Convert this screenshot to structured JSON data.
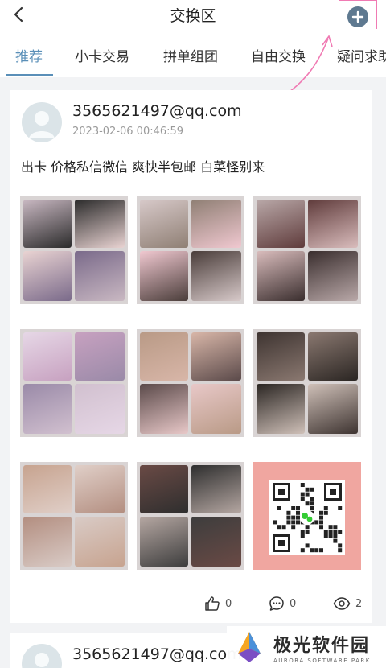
{
  "header": {
    "title": "交换区"
  },
  "tabs": [
    {
      "label": "推荐",
      "active": true
    },
    {
      "label": "小卡交易",
      "active": false
    },
    {
      "label": "拼单组团",
      "active": false
    },
    {
      "label": "自由交换",
      "active": false
    },
    {
      "label": "疑问求助",
      "active": false
    }
  ],
  "posts": [
    {
      "username": "3565621497@qq.com",
      "timestamp": "2023-02-06 00:46:59",
      "text": "出卡 价格私信微信 爽快半包邮 白菜怪别来",
      "photos": [
        {
          "kind": "photocard-binder-page",
          "colors": [
            "#c9b8c2",
            "#2b2b2b",
            "#e9d3d2",
            "#7a6a8a"
          ]
        },
        {
          "kind": "photocard-binder-page",
          "colors": [
            "#d7c9c9",
            "#8f7f74",
            "#f0c8d0",
            "#4a3d3a"
          ]
        },
        {
          "kind": "photocard-binder-page",
          "colors": [
            "#b9a8a8",
            "#5f3b3b",
            "#d9bcbc",
            "#3a2e2e"
          ]
        },
        {
          "kind": "photocard-binder-page",
          "colors": [
            "#e6d7e6",
            "#c7a1c0",
            "#9a8aa8",
            "#d1c0cf"
          ]
        },
        {
          "kind": "photocard-binder-page",
          "colors": [
            "#b99a86",
            "#d8b6a8",
            "#5b4a4a",
            "#e8c8c8"
          ]
        },
        {
          "kind": "photocard-binder-page",
          "colors": [
            "#3e3431",
            "#8a7870",
            "#2b2623",
            "#cfc0b8"
          ]
        },
        {
          "kind": "photocard-binder-page",
          "colors": [
            "#c7a38f",
            "#e0cfc8",
            "#b38e80",
            "#d9cbc6"
          ]
        },
        {
          "kind": "photocard-binder-page",
          "colors": [
            "#6a4a45",
            "#2e2e2e",
            "#b5a7a2",
            "#3d3d3d"
          ]
        },
        {
          "kind": "wechat-qr-code",
          "colors": [
            "#f0a6a0",
            "#ffffff"
          ]
        }
      ],
      "likes": "0",
      "comments": "0",
      "views": "2"
    },
    {
      "username": "3565621497@qq.com"
    }
  ],
  "watermark": {
    "name_cn": "极光软件园",
    "name_en": "AURORA SOFTWARE PARK"
  },
  "icons": {
    "back": "chevron-left-icon",
    "add": "plus-circle-icon",
    "like": "thumbs-up-icon",
    "comment": "chat-bubble-icon",
    "view": "eye-icon"
  },
  "colors": {
    "accent": "#5a8fb8",
    "annotation": "#f07ab3",
    "background": "#f2f3f5"
  }
}
